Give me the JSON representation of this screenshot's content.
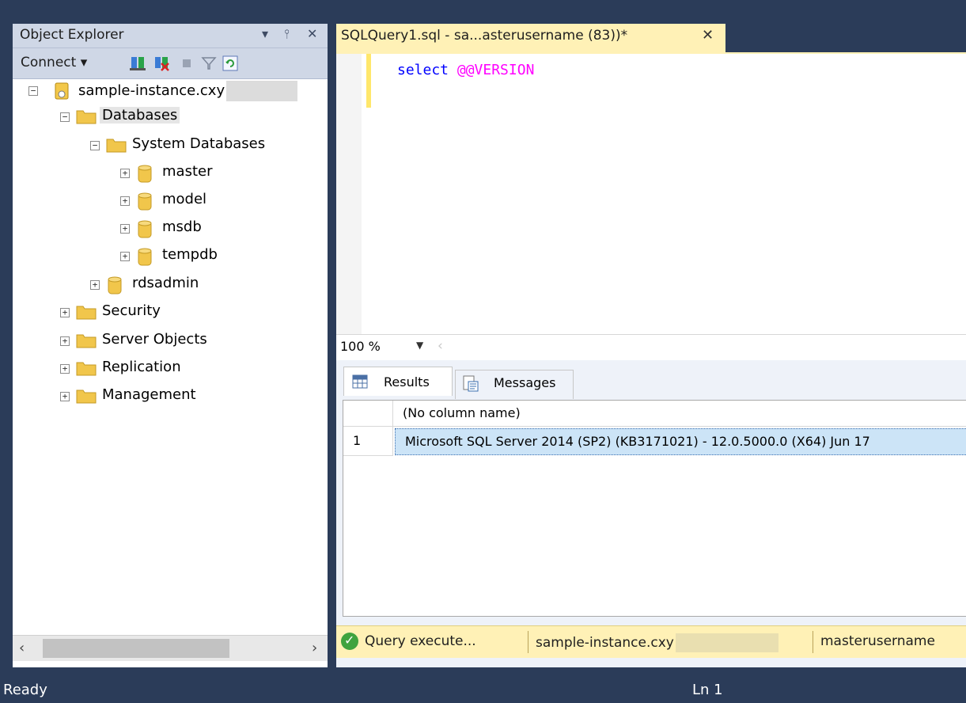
{
  "object_explorer": {
    "title": "Object Explorer",
    "controls": {
      "dropdown": "▾",
      "pin": "⫯",
      "close": "✕"
    },
    "toolbar": {
      "connect_label": "Connect ▾"
    },
    "tree": {
      "server": "sample-instance.cxy",
      "databases": "Databases",
      "system_databases": "System Databases",
      "master": "master",
      "model": "model",
      "msdb": "msdb",
      "tempdb": "tempdb",
      "rdsadmin": "rdsadmin",
      "security": "Security",
      "server_objects": "Server Objects",
      "replication": "Replication",
      "management": "Management"
    },
    "scroll": {
      "left": "‹",
      "right": "›"
    }
  },
  "document": {
    "tab_label": "SQLQuery1.sql - sa...asterusername (83))*",
    "tab_close": "✕",
    "code": {
      "keyword": "select",
      "function": "@@VERSION"
    },
    "zoom": "100 %",
    "zoom_arrow": "▼",
    "zoom_sep": "‹"
  },
  "results": {
    "tabs": {
      "results": "Results",
      "messages": "Messages"
    },
    "column_header": "(No column name)",
    "rows": [
      {
        "num": "1",
        "value": "Microsoft SQL Server 2014 (SP2) (KB3171021) - 12.0.5000.0 (X64)   Jun 17"
      }
    ]
  },
  "query_status": {
    "message": "Query execute...",
    "server": "sample-instance.cxy",
    "user": "masterusername"
  },
  "app_status": {
    "left": "Ready",
    "line": "Ln 1"
  },
  "colors": {
    "accent": "#2b3c59",
    "doc_tab": "#fff1b6",
    "keyword": "#0000ff",
    "function": "#ff00ff"
  }
}
